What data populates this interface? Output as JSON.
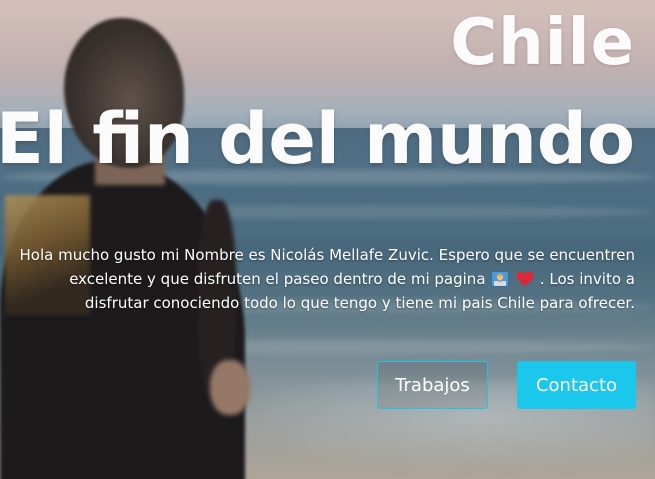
{
  "hero": {
    "title_line1": "Chile",
    "title_line2": "El fin del mundo",
    "intro_part1": "Hola mucho gusto mi Nombre es Nicolás Mellafe Zuvic. Espero que se encuentren excelente y que disfruten el paseo dentro de mi pagina",
    "intro_part2": ". Los invito a disfrutar conociendo todo lo que tengo y tiene mi pais Chile para ofrecer.",
    "emoji_icons": [
      "man-technologist-icon",
      "red-heart-icon"
    ]
  },
  "buttons": {
    "trabajos_label": "Trabajos",
    "contacto_label": "Contacto"
  },
  "colors": {
    "accent": "#1cc7ec",
    "text": "#ffffff",
    "heart": "#d8283a"
  }
}
